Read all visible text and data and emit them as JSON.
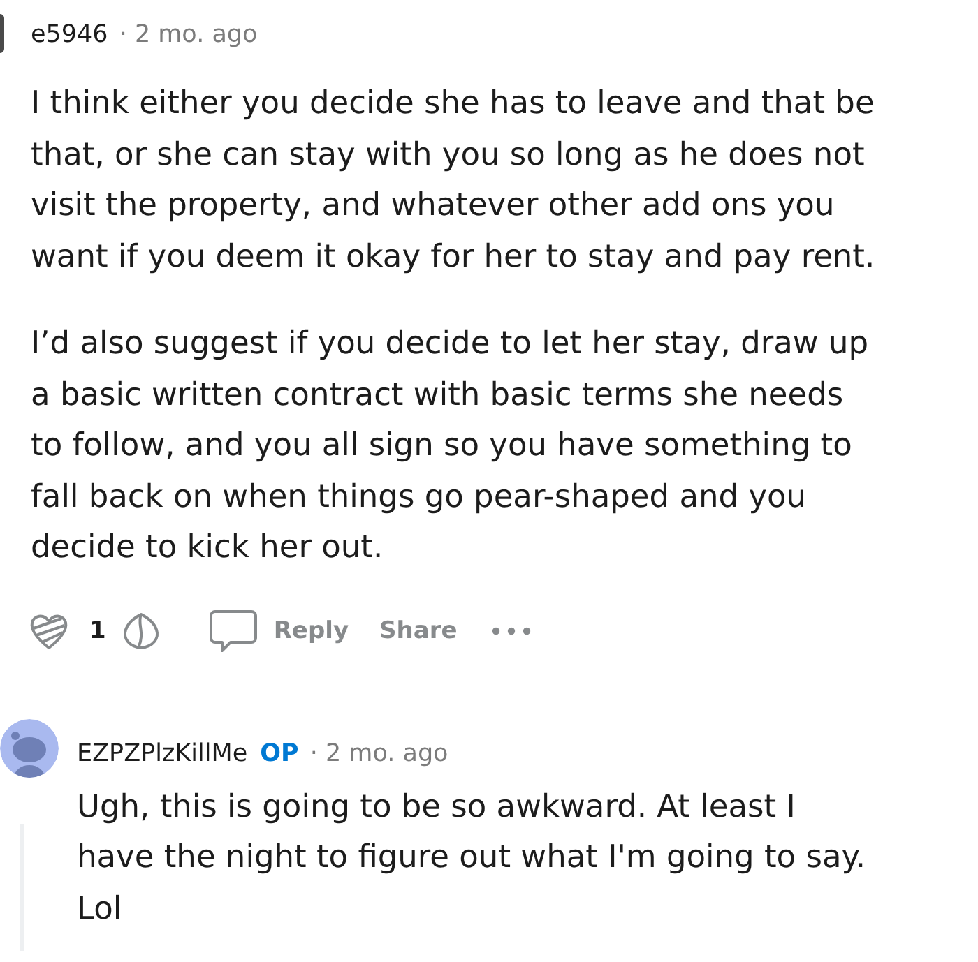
{
  "comments": [
    {
      "kind": "cropped",
      "username": "e5946",
      "time": "· 2 mo. ago",
      "paragraphs": [
        "I think either you decide she has to leave and that be that, or she can stay with you so long as he does not visit the property, and whatever other add ons you want if you deem it okay for her to stay and pay rent.",
        "I’d also suggest if you decide to let her stay, draw up a basic written contract with basic terms she needs to follow, and you all sign so you have something to fall back on when things go pear-shaped and you decide to kick her out."
      ],
      "actions": {
        "score": "1",
        "reply": "Reply",
        "share": "Share"
      }
    },
    {
      "kind": "full",
      "username": "EZPZPlzKillMe",
      "badge": "OP",
      "time": "· 2 mo. ago",
      "paragraphs": [
        "Ugh, this is going to be so awkward. At least I have the night to figure out what I'm going to say. Lol"
      ]
    }
  ]
}
